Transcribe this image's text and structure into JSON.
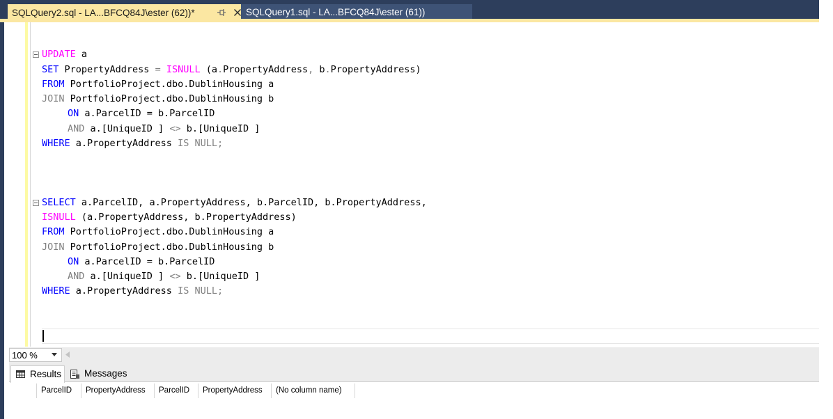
{
  "tabs": [
    {
      "label": "SQLQuery2.sql - LA...BFCQ84J\\ester (62))*",
      "active": true
    },
    {
      "label": "SQLQuery1.sql - LA...BFCQ84J\\ester (61))",
      "active": false
    }
  ],
  "code": {
    "update_block": {
      "l1_kw": "UPDATE",
      "l1_rest": " a",
      "l2_kw": "SET",
      "l2_a": " PropertyAddress ",
      "l2_eq": "=",
      "l2_sp": " ",
      "l2_fn": "ISNULL",
      "l2_b": " (a",
      "l2_dot1": ".",
      "l2_c": "PropertyAddress",
      "l2_comma": ",",
      "l2_d": " b",
      "l2_dot2": ".",
      "l2_e": "PropertyAddress)",
      "l3_kw": "FROM",
      "l3_rest": " PortfolioProject.dbo.DublinHousing a",
      "l4_kw": "JOIN",
      "l4_rest": " PortfolioProject.dbo.DublinHousing b",
      "l5_kw": "ON",
      "l5_rest": " a.ParcelID = b.ParcelID",
      "l6_kw": "AND",
      "l6_a": " a.[UniqueID ] ",
      "l6_op": "<>",
      "l6_b": " b.[UniqueID ]",
      "l7_kw": "WHERE",
      "l7_a": " a.PropertyAddress ",
      "l7_kw2": "IS NULL",
      "l7_semi": ";"
    },
    "select_block": {
      "l1_kw": "SELECT",
      "l1_rest": " a.ParcelID, a.PropertyAddress, b.ParcelID, b.PropertyAddress,",
      "l2_fn": "ISNULL",
      "l2_rest": " (a.PropertyAddress, b.PropertyAddress)",
      "l3_kw": "FROM",
      "l3_rest": " PortfolioProject.dbo.DublinHousing a",
      "l4_kw": "JOIN",
      "l4_rest": " PortfolioProject.dbo.DublinHousing b",
      "l5_kw": "ON",
      "l5_rest": " a.ParcelID = b.ParcelID",
      "l6_kw": "AND",
      "l6_a": " a.[UniqueID ] ",
      "l6_op": "<>",
      "l6_b": " b.[UniqueID ]",
      "l7_kw": "WHERE",
      "l7_a": " a.PropertyAddress ",
      "l7_kw2": "IS NULL",
      "l7_semi": ";"
    }
  },
  "zoom": {
    "value": "100 %"
  },
  "results_tabs": [
    {
      "label": "Results",
      "icon": "grid-icon"
    },
    {
      "label": "Messages",
      "icon": "messages-icon"
    }
  ],
  "grid_columns": [
    "ParcelID",
    "PropertyAddress",
    "ParcelID",
    "PropertyAddress",
    "(No column name)"
  ],
  "colors": {
    "keyword": "#0000ff",
    "function": "#ff00ff",
    "operator_gray": "#808080",
    "active_tab": "#fbe7a2",
    "tab_strip": "#2d3e5c",
    "inactive_tab": "#3e5376",
    "change_margin": "#fdfaa4"
  }
}
